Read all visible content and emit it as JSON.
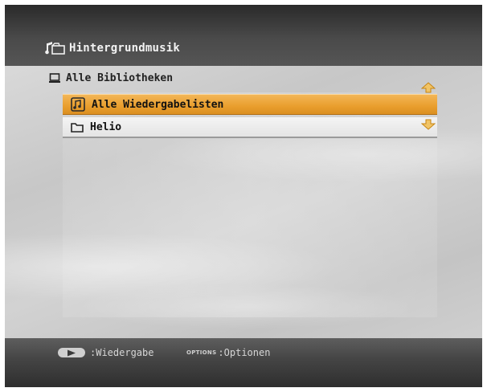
{
  "header": {
    "title": "Hintergrundmusik",
    "icon": "music-folder-icon"
  },
  "breadcrumb": {
    "label": "Alle Bibliotheken",
    "icon": "library-icon"
  },
  "list": {
    "items": [
      {
        "label": "Alle Wiedergabelisten",
        "icon": "playlist-icon",
        "selected": true
      },
      {
        "label": "Helio",
        "icon": "folder-icon",
        "selected": false
      }
    ]
  },
  "footer": {
    "play_key_icon": "play-button-icon",
    "play_label": ":Wiedergabe",
    "options_key": "OPTIONS",
    "options_label": ":Optionen"
  },
  "colors": {
    "selection": "#e99e2d",
    "scroll_arrow": "#e5a020"
  }
}
